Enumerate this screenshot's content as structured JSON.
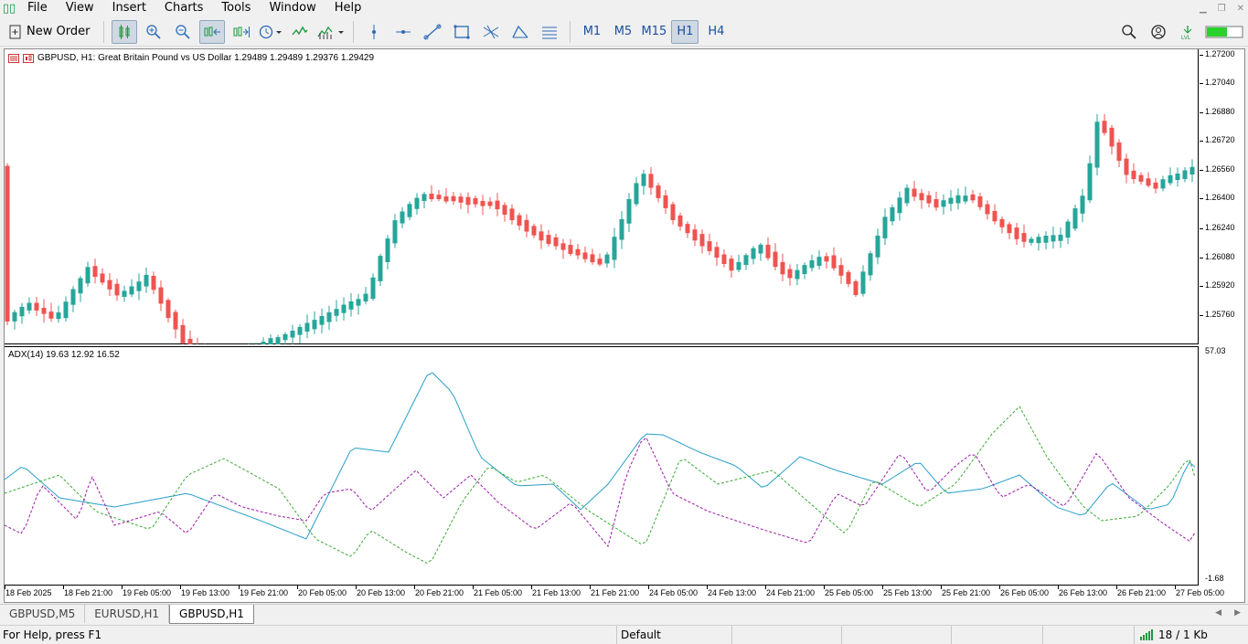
{
  "menu": [
    "File",
    "View",
    "Insert",
    "Charts",
    "Tools",
    "Window",
    "Help"
  ],
  "toolbar": {
    "new_order_label": "New Order",
    "timeframes": [
      "M1",
      "M5",
      "M15",
      "H1",
      "H4"
    ],
    "active_timeframe": "H1"
  },
  "chart": {
    "symbol_info": "GBPUSD, H1:  Great Britain Pound vs US Dollar  1.29489 1.29489 1.29376 1.29429",
    "price_labels": [
      "1.27200",
      "1.27040",
      "1.26880",
      "1.26720",
      "1.26560",
      "1.26400",
      "1.26240",
      "1.26080",
      "1.25920",
      "1.25760"
    ],
    "time_labels": [
      "18 Feb 2025",
      "18 Feb 21:00",
      "19 Feb 05:00",
      "19 Feb 13:00",
      "19 Feb 21:00",
      "20 Feb 05:00",
      "20 Feb 13:00",
      "20 Feb 21:00",
      "21 Feb 05:00",
      "21 Feb 13:00",
      "21 Feb 21:00",
      "24 Feb 05:00",
      "24 Feb 13:00",
      "24 Feb 21:00",
      "25 Feb 05:00",
      "25 Feb 13:00",
      "25 Feb 21:00",
      "26 Feb 05:00",
      "26 Feb 13:00",
      "26 Feb 21:00",
      "27 Feb 05:00"
    ],
    "colors": {
      "bull": "#26a69a",
      "bear": "#ef5350",
      "adx": "#2a9fc9",
      "plus_di": "#3aaa35",
      "minus_di": "#9c1aa8"
    }
  },
  "indicator": {
    "info": "ADX(14) 19.63 12.92 16.52",
    "top_label": "57.03",
    "bottom_label": "-1.68"
  },
  "tabs": [
    {
      "label": "GBPUSD,M5",
      "active": false
    },
    {
      "label": "EURUSD,H1",
      "active": false
    },
    {
      "label": "GBPUSD,H1",
      "active": true
    }
  ],
  "status": {
    "help": "For Help, press F1",
    "profile": "Default",
    "traffic": "18 / 1 Kb"
  }
}
